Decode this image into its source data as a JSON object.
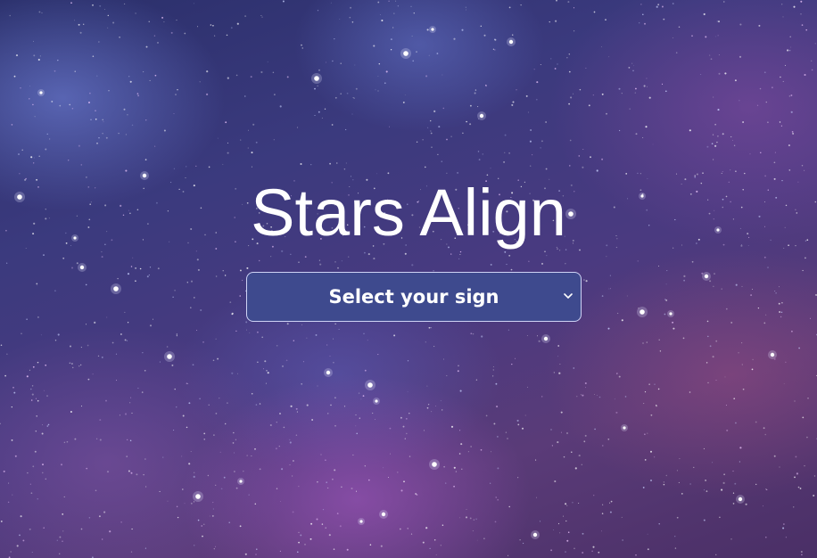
{
  "hero": {
    "title": "Stars Align"
  },
  "sign_select": {
    "selected": "Select your sign",
    "icon": "chevron-down-icon"
  },
  "colors": {
    "title": "#ffffff",
    "select_bg": "#3e4a8e",
    "select_border": "#cfd3f5"
  }
}
